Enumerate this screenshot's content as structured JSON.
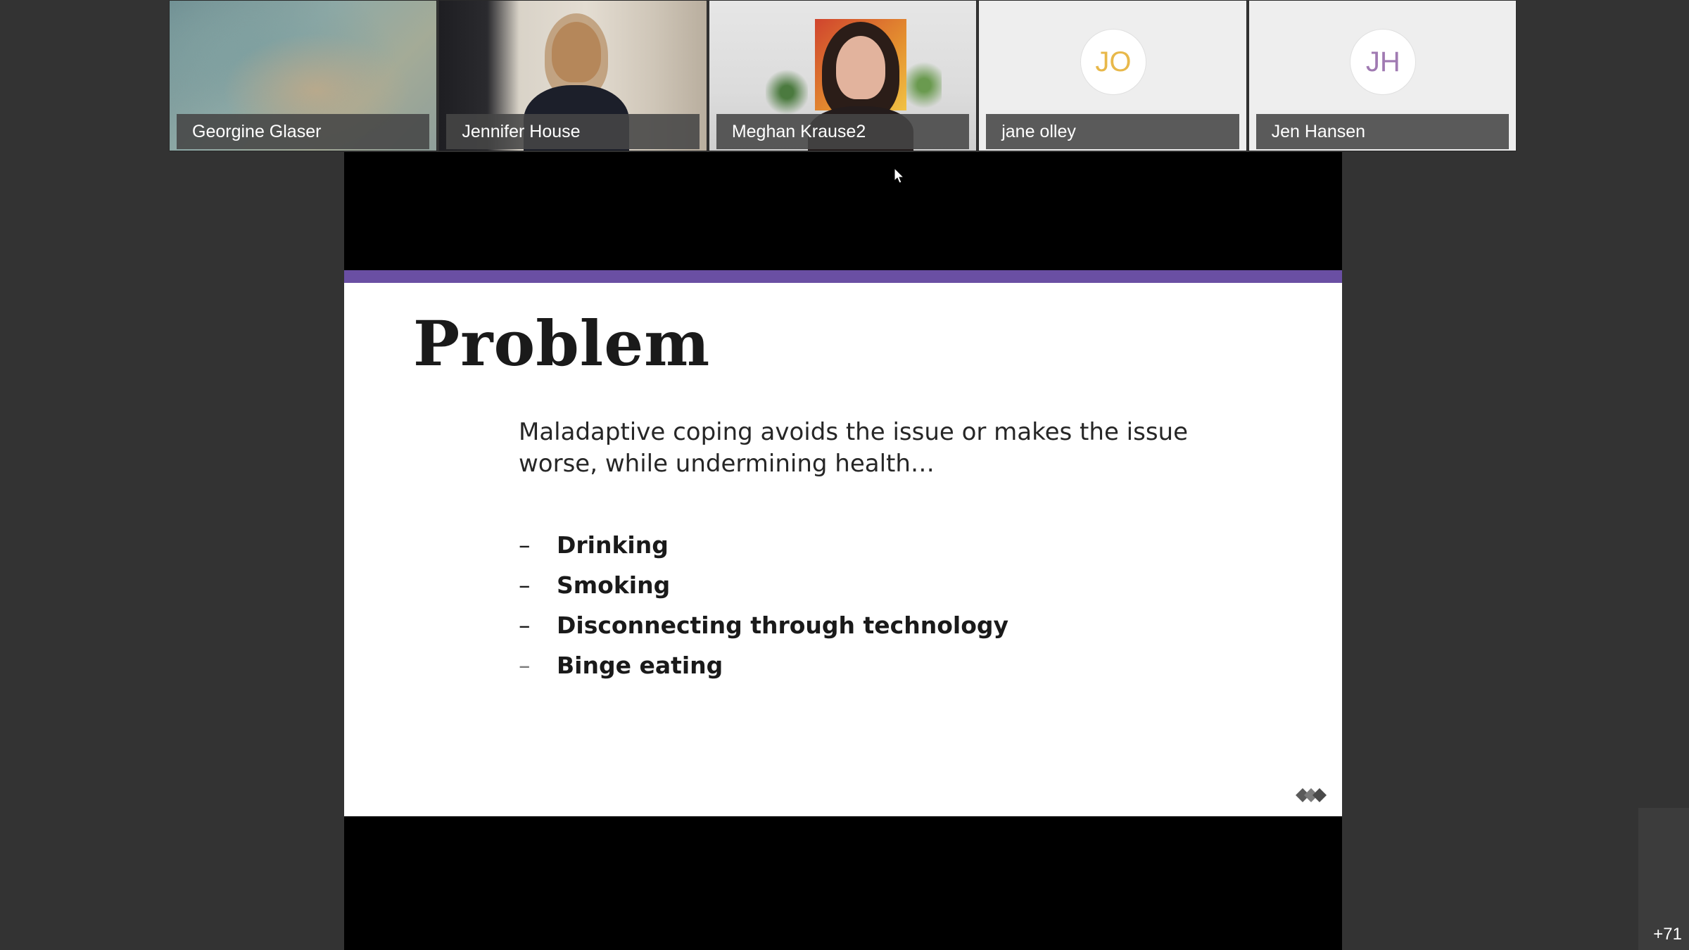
{
  "participants": [
    {
      "name": "Georgine Glaser",
      "type": "video"
    },
    {
      "name": "Jennifer House",
      "type": "video"
    },
    {
      "name": "Meghan Krause2",
      "type": "video"
    },
    {
      "name": "jane olley",
      "type": "avatar",
      "initials": "JO",
      "initials_color": "#E8B84A"
    },
    {
      "name": "Jen Hansen",
      "type": "avatar",
      "initials": "JH",
      "initials_color": "#A07AB2"
    }
  ],
  "slide": {
    "title": "Problem",
    "body": "Maladaptive coping avoids the issue or makes the issue worse, while undermining health…",
    "bullets": [
      {
        "dash": "–",
        "text": "Drinking"
      },
      {
        "dash": "–",
        "text": "Smoking"
      },
      {
        "dash": "–",
        "text": "Disconnecting through technology"
      },
      {
        "dash": "–",
        "text": "Binge eating"
      }
    ],
    "accent_color": "#6A4FA3"
  },
  "more_participants": "+71",
  "colors": {
    "background": "#333333",
    "name_bar": "#464646",
    "share_background": "#000000"
  }
}
